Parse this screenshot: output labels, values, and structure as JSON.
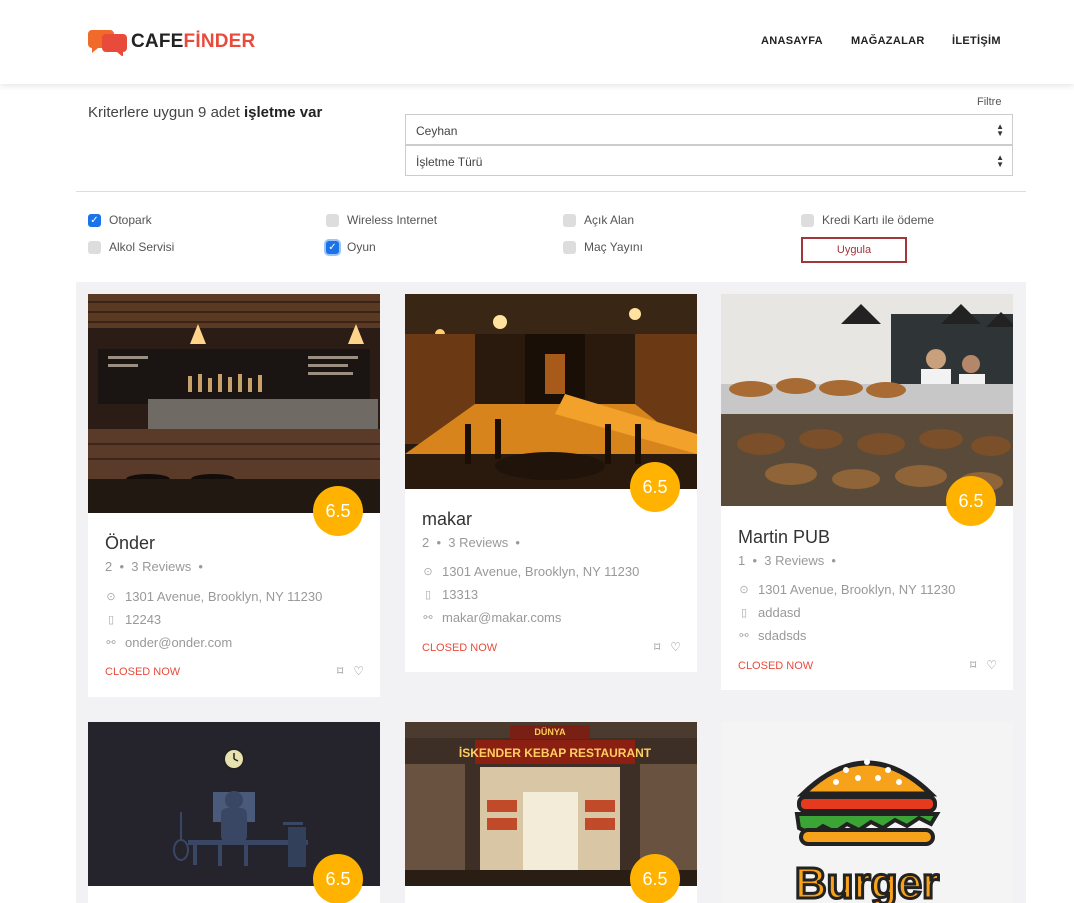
{
  "brand": {
    "part1": "CAFE",
    "part2": "FİNDER",
    "logo_icon": "chat-bubbles-icon",
    "colors": {
      "accent": "#e84b3c",
      "logo_orange": "#f06a29",
      "score": "#ffb300"
    }
  },
  "nav": {
    "home": "ANASAYFA",
    "stores": "MAĞAZALAR",
    "contact": "İLETİŞİM"
  },
  "results": {
    "prefix": "Kriterlere uygun 9 adet",
    "suffix": "işletme var"
  },
  "filter": {
    "label": "Filtre",
    "city": "Ceyhan",
    "type": "İşletme Türü"
  },
  "checkboxes": [
    {
      "label": "Otopark",
      "checked": true
    },
    {
      "label": "Wireless Internet",
      "checked": false
    },
    {
      "label": "Açık Alan",
      "checked": false
    },
    {
      "label": "Kredi Kartı ile ödeme",
      "checked": false
    },
    {
      "label": "Alkol Servisi",
      "checked": false
    },
    {
      "label": "Oyun",
      "checked": true
    },
    {
      "label": "Maç Yayını",
      "checked": false
    }
  ],
  "apply_label": "Uygula",
  "cards": [
    {
      "name": "Önder",
      "score": "6.5",
      "meta1": "2",
      "meta2": "3 Reviews",
      "address": "1301 Avenue, Brooklyn, NY 11230",
      "phone": "12243",
      "email": "onder@onder.com",
      "status": "CLOSED NOW",
      "image": "bar-interior-photo"
    },
    {
      "name": "makar",
      "score": "6.5",
      "meta1": "2",
      "meta2": "3 Reviews",
      "address": "1301 Avenue, Brooklyn, NY 11230",
      "phone": "13313",
      "email": "makar@makar.coms",
      "status": "CLOSED NOW",
      "image": "pub-interior-photo"
    },
    {
      "name": "Martin PUB",
      "score": "6.5",
      "meta1": "1",
      "meta2": "3 Reviews",
      "address": "1301 Avenue, Brooklyn, NY 11230",
      "phone": "addasd",
      "email": "sdadsds",
      "status": "CLOSED NOW",
      "image": "bakery-photo"
    },
    {
      "score": "6.5",
      "image": "desk-illustration"
    },
    {
      "score": "6.5",
      "image": "kebab-restaurant-photo",
      "sign_top": "DÜNYA",
      "sign": "İSKENDER KEBAP RESTAURANT"
    },
    {
      "image": "burger-logo",
      "logo_text": "Burger"
    }
  ]
}
